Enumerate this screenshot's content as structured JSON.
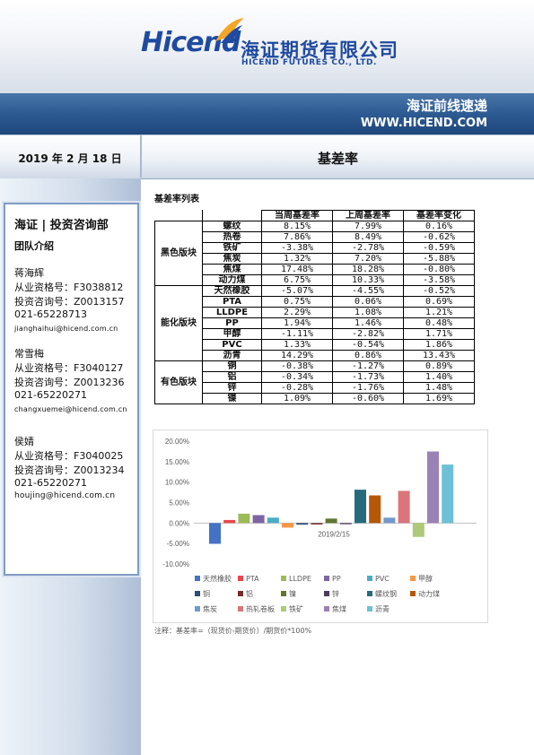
{
  "header": {
    "logo_word": "Hicend",
    "logo_cn": "海证期货有限公司",
    "logo_en": "HICEND FUTURES CO., LTD.",
    "band_title": "海证前线速递",
    "band_url": "WWW.HICEND.COM",
    "brand_color": "#1f4aa0"
  },
  "date": "2019 年 2 月 18 日",
  "title": "基差率",
  "sidebar": {
    "dept": "海证 | 投资咨询部",
    "team_label": "团队介绍",
    "analysts": [
      {
        "name": "蒋海辉",
        "license": "从业资格号：F3038812",
        "consult": "投资咨询号：Z0013157",
        "phone": "021-65228713",
        "email": "jianghaihui@hicend.com.cn"
      },
      {
        "name": "常雪梅",
        "license": "从业资格号：F3040127",
        "consult": "投资咨询号：Z0013236",
        "phone": "021-65220271",
        "email": "changxuemei@hicend.com.cn"
      },
      {
        "name": "侯婧",
        "license": "从业资格号：F3040025",
        "consult": "投资咨询号：Z0013234",
        "phone": "021-65220271",
        "email": "houjing@hicend.com.cn"
      }
    ]
  },
  "table": {
    "title": "基差率列表",
    "headers": [
      "当周基差率",
      "上周基差率",
      "基差率变化"
    ],
    "sections": [
      {
        "name": "黑色版块",
        "rows": [
          [
            "螺纹",
            "8.15%",
            "7.99%",
            "0.16%"
          ],
          [
            "热卷",
            "7.86%",
            "8.49%",
            "-0.62%"
          ],
          [
            "铁矿",
            "-3.38%",
            "-2.78%",
            "-0.59%"
          ],
          [
            "焦炭",
            "1.32%",
            "7.20%",
            "-5.88%"
          ],
          [
            "焦煤",
            "17.48%",
            "18.28%",
            "-0.80%"
          ],
          [
            "动力煤",
            "6.75%",
            "10.33%",
            "-3.58%"
          ]
        ]
      },
      {
        "name": "能化版块",
        "rows": [
          [
            "天然橡胶",
            "-5.07%",
            "-4.55%",
            "-0.52%"
          ],
          [
            "PTA",
            "0.75%",
            "0.06%",
            "0.69%"
          ],
          [
            "LLDPE",
            "2.29%",
            "1.08%",
            "1.21%"
          ],
          [
            "PP",
            "1.94%",
            "1.46%",
            "0.48%"
          ],
          [
            "甲醇",
            "-1.11%",
            "-2.82%",
            "1.71%"
          ],
          [
            "PVC",
            "1.33%",
            "-0.54%",
            "1.86%"
          ],
          [
            "沥青",
            "14.29%",
            "0.86%",
            "13.43%"
          ]
        ]
      },
      {
        "name": "有色版块",
        "rows": [
          [
            "铜",
            "-0.38%",
            "-1.27%",
            "0.89%"
          ],
          [
            "铝",
            "-0.34%",
            "-1.73%",
            "1.40%"
          ],
          [
            "锌",
            "-0.28%",
            "-1.76%",
            "1.48%"
          ],
          [
            "镍",
            "1.09%",
            "-0.60%",
            "1.69%"
          ]
        ]
      }
    ]
  },
  "chart_data": {
    "type": "bar",
    "categories": [
      "2019/2/15"
    ],
    "ylim": [
      -10,
      20
    ],
    "yticks": [
      "20.00%",
      "15.00%",
      "10.00%",
      "5.00%",
      "0.00%",
      "-5.00%",
      "-10.00%"
    ],
    "series": [
      {
        "name": "天然橡胶",
        "color": "#4472c4",
        "value": -5.07
      },
      {
        "name": "PTA",
        "color": "#e8454e",
        "value": 0.75
      },
      {
        "name": "LLDPE",
        "color": "#9bbb59",
        "value": 2.29
      },
      {
        "name": "PP",
        "color": "#8064a2",
        "value": 1.94
      },
      {
        "name": "PVC",
        "color": "#4bacc6",
        "value": 1.33
      },
      {
        "name": "甲醇",
        "color": "#f79646",
        "value": -1.11
      },
      {
        "name": "铜",
        "color": "#2c4d75",
        "value": -0.38
      },
      {
        "name": "铝",
        "color": "#772c2a",
        "value": -0.34
      },
      {
        "name": "镍",
        "color": "#5f7530",
        "value": 1.09
      },
      {
        "name": "锌",
        "color": "#4d3b62",
        "value": -0.28
      },
      {
        "name": "螺纹钢",
        "color": "#276a7c",
        "value": 8.15
      },
      {
        "name": "动力煤",
        "color": "#b65708",
        "value": 6.75
      },
      {
        "name": "焦炭",
        "color": "#729aca",
        "value": 1.32
      },
      {
        "name": "热轧卷板",
        "color": "#d9757b",
        "value": 7.86
      },
      {
        "name": "铁矿",
        "color": "#afc97a",
        "value": -3.38
      },
      {
        "name": "焦煤",
        "color": "#9a82b6",
        "value": 17.48
      },
      {
        "name": "沥青",
        "color": "#6cc1d5",
        "value": 14.29
      }
    ]
  },
  "note": "注释：基差率=（现货价-期货价）/期货价*100%"
}
